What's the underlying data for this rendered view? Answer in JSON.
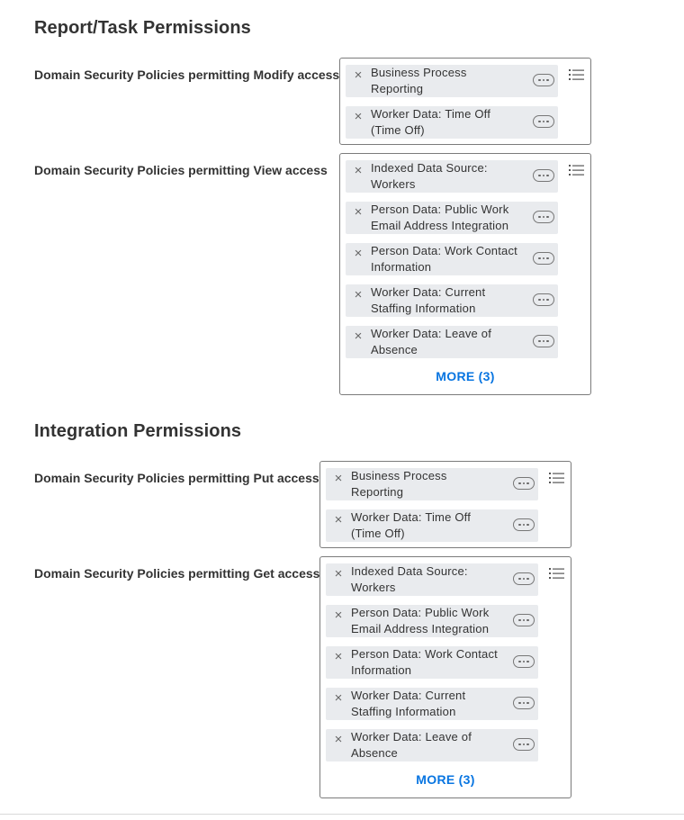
{
  "sections": [
    {
      "title": "Report/Task Permissions",
      "fields": [
        {
          "label": "Domain Security Policies permitting Modify access",
          "items": [
            [
              "Business Process",
              "Reporting"
            ],
            [
              "Worker Data: Time Off",
              "(Time Off)"
            ]
          ]
        },
        {
          "label": "Domain Security Policies permitting View access",
          "items": [
            [
              "Indexed Data Source:",
              "Workers"
            ],
            [
              "Person Data: Public Work",
              "Email Address Integration"
            ],
            [
              "Person Data: Work Contact",
              "Information"
            ],
            [
              "Worker Data: Current",
              "Staffing Information"
            ],
            [
              "Worker Data: Leave of",
              "Absence"
            ]
          ],
          "more_label": "MORE (3)"
        }
      ]
    },
    {
      "title": "Integration Permissions",
      "fields": [
        {
          "label": "Domain Security Policies permitting Put access",
          "items": [
            [
              "Business Process",
              "Reporting"
            ],
            [
              "Worker Data: Time Off",
              "(Time Off)"
            ]
          ]
        },
        {
          "label": "Domain Security Policies permitting Get access",
          "items": [
            [
              "Indexed Data Source:",
              "Workers"
            ],
            [
              "Person Data: Public Work",
              "Email Address Integration"
            ],
            [
              "Person Data: Work Contact",
              "Information"
            ],
            [
              "Worker Data: Current",
              "Staffing Information"
            ],
            [
              "Worker Data: Leave of",
              "Absence"
            ]
          ],
          "more_label": "MORE (3)"
        }
      ]
    }
  ],
  "icons": {
    "remove": "close-icon",
    "related_actions": "ellipsis-icon",
    "prompt": "list-icon"
  },
  "colors": {
    "link": "#0875e1",
    "pill_bg": "#e9ebee",
    "box_border": "#7b7b7b"
  }
}
